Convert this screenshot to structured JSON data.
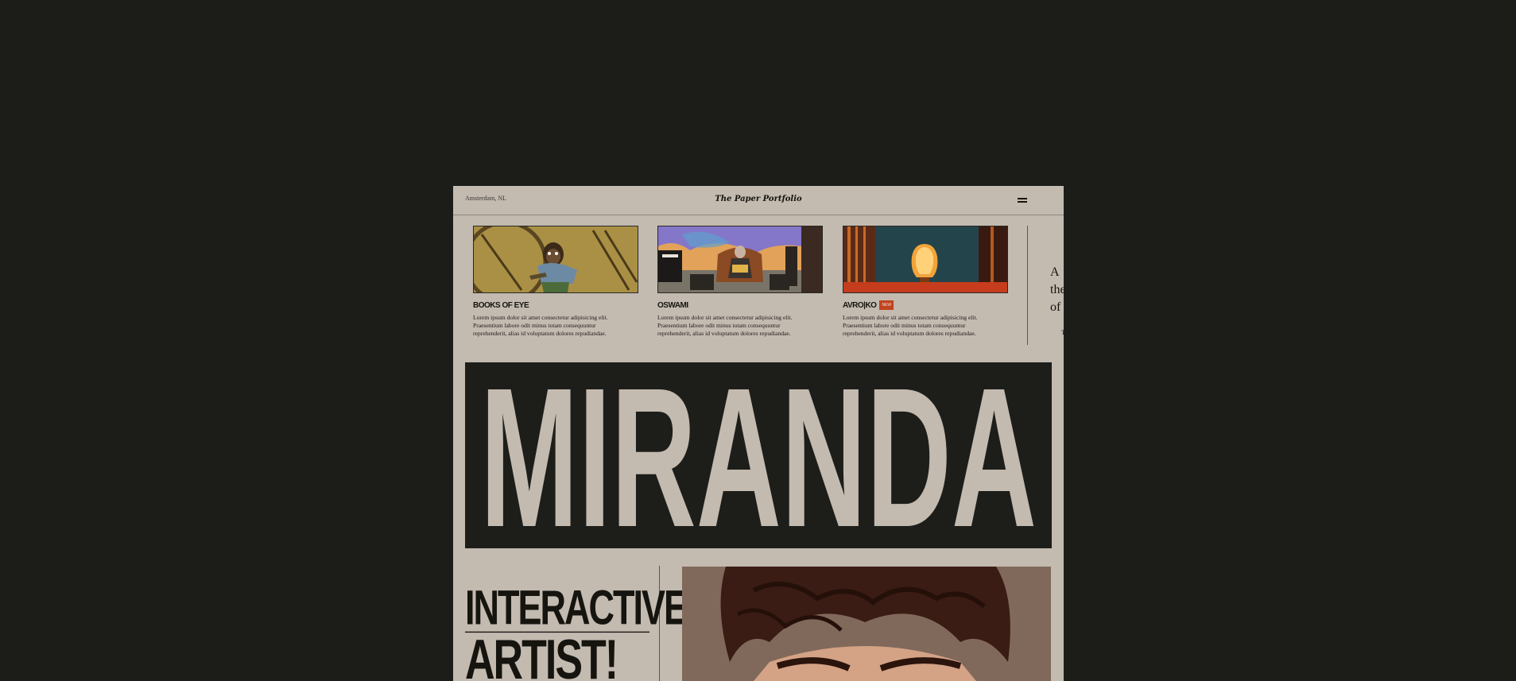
{
  "header": {
    "location": "Amsterdam, NL",
    "brand": "The Paper Portfolio",
    "menu_icon": "hamburger-icon"
  },
  "projects": [
    {
      "title": "BOOKS OF EYE",
      "description": "Lorem ipsum dolor sit amet consectetur adipisicing elit.\nPraesentium labore odit minus totam consequuntur\nreprehenderit, alias id voluptatum dolores repudiandae.",
      "badge": ""
    },
    {
      "title": "OSWAMI",
      "description": "Lorem ipsum dolor sit amet consectetur adipisicing elit.\nPraesentium labore odit minus totam consequuntur\nreprehenderit, alias id voluptatum dolores repudiandae.",
      "badge": ""
    },
    {
      "title": "AVRO|KO",
      "description": "Lorem ipsum dolor sit amet consectetur adipisicing elit.\nPraesentium labore odit minus totam consequuntur\nreprehenderit, alias id voluptatum dolores repudiandae.",
      "badge": "NEW"
    }
  ],
  "sidebar": {
    "partial_text": "A\nthe\nof",
    "partial_small": "T"
  },
  "hero": {
    "name": "MIRANDA"
  },
  "tagline": {
    "line1": "INTERACTIVE",
    "line2": "ARTIST!"
  },
  "colors": {
    "background": "#1c1d19",
    "paper": "#c3bab0",
    "ink": "#15140f",
    "accent": "#c2431f"
  }
}
